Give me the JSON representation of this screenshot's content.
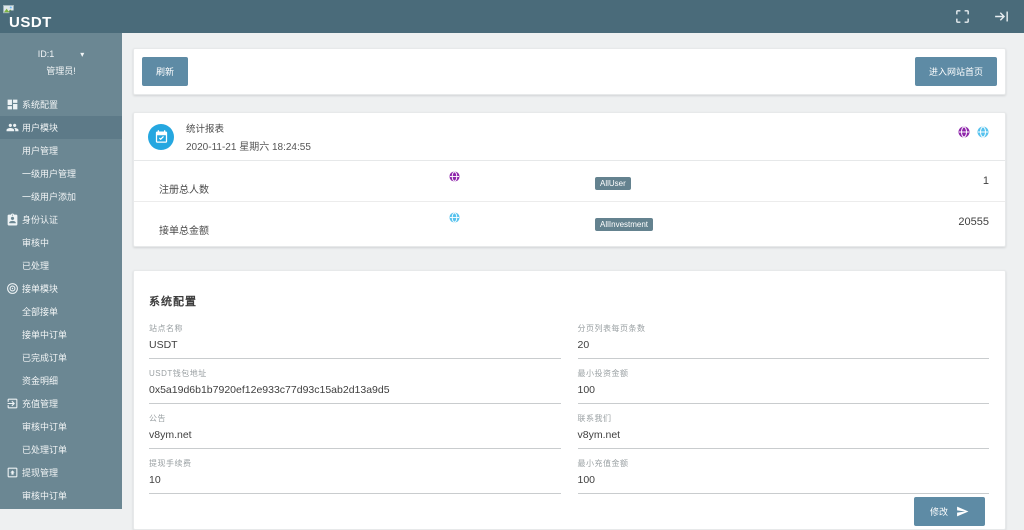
{
  "topbar": {
    "brand": "USDT"
  },
  "icons": {
    "caret_down": "▾"
  },
  "sidebar": {
    "profile": {
      "id": "ID:1",
      "role": "管理员!"
    },
    "items": [
      {
        "label": "系统配置",
        "type": "section",
        "icon": "dashboard-icon"
      },
      {
        "label": "用户模块",
        "type": "section",
        "icon": "users-icon",
        "active": true
      },
      {
        "label": "用户管理",
        "type": "sub"
      },
      {
        "label": "一级用户管理",
        "type": "sub"
      },
      {
        "label": "一级用户添加",
        "type": "sub"
      },
      {
        "label": "身份认证",
        "type": "section",
        "icon": "id-badge-icon"
      },
      {
        "label": "审核中",
        "type": "sub"
      },
      {
        "label": "已处理",
        "type": "sub"
      },
      {
        "label": "接单模块",
        "type": "section",
        "icon": "target-icon"
      },
      {
        "label": "全部接单",
        "type": "sub"
      },
      {
        "label": "接单中订单",
        "type": "sub"
      },
      {
        "label": "已完成订单",
        "type": "sub"
      },
      {
        "label": "资金明细",
        "type": "sub"
      },
      {
        "label": "充值管理",
        "type": "section",
        "icon": "login-box-icon"
      },
      {
        "label": "审核中订单",
        "type": "sub"
      },
      {
        "label": "已处理订单",
        "type": "sub"
      },
      {
        "label": "提现管理",
        "type": "section",
        "icon": "upload-box-icon"
      },
      {
        "label": "审核中订单",
        "type": "sub"
      }
    ]
  },
  "toolbar": {
    "refresh_label": "刷新",
    "home_label": "进入网站首页"
  },
  "stats": {
    "title": "统计报表",
    "datetime": "2020-11-21 星期六 18:24:55",
    "rows": [
      {
        "label": "注册总人数",
        "badge": "AllUser",
        "value": "1",
        "icon_color": "#8e24aa"
      },
      {
        "label": "接单总金额",
        "badge": "AllInvestment",
        "value": "20555",
        "icon_color": "#56c2ee"
      }
    ]
  },
  "config": {
    "title": "系统配置",
    "left": [
      {
        "label": "站点名称",
        "value": "USDT"
      },
      {
        "label": "USDT钱包地址",
        "value": "0x5a19d6b1b7920ef12e933c77d93c15ab2d13a9d5"
      },
      {
        "label": "公告",
        "value": "v8ym.net"
      },
      {
        "label": "提现手续费",
        "value": "10"
      }
    ],
    "right": [
      {
        "label": "分页列表每页条数",
        "value": "20"
      },
      {
        "label": "最小投资金额",
        "value": "100"
      },
      {
        "label": "联系我们",
        "value": "v8ym.net"
      },
      {
        "label": "最小充值金额",
        "value": "100"
      }
    ],
    "submit_label": "修改"
  },
  "colors": {
    "topbar": "#4a6b7a",
    "sidebar": "#6b8793",
    "sidebar_active": "#5d7a88",
    "button": "#5e8ba5",
    "badge": "#64828f",
    "stat_icon_blue": "#25a7e0",
    "purple": "#8e24aa",
    "cyan": "#56c2ee",
    "background": "#eef0f1"
  }
}
